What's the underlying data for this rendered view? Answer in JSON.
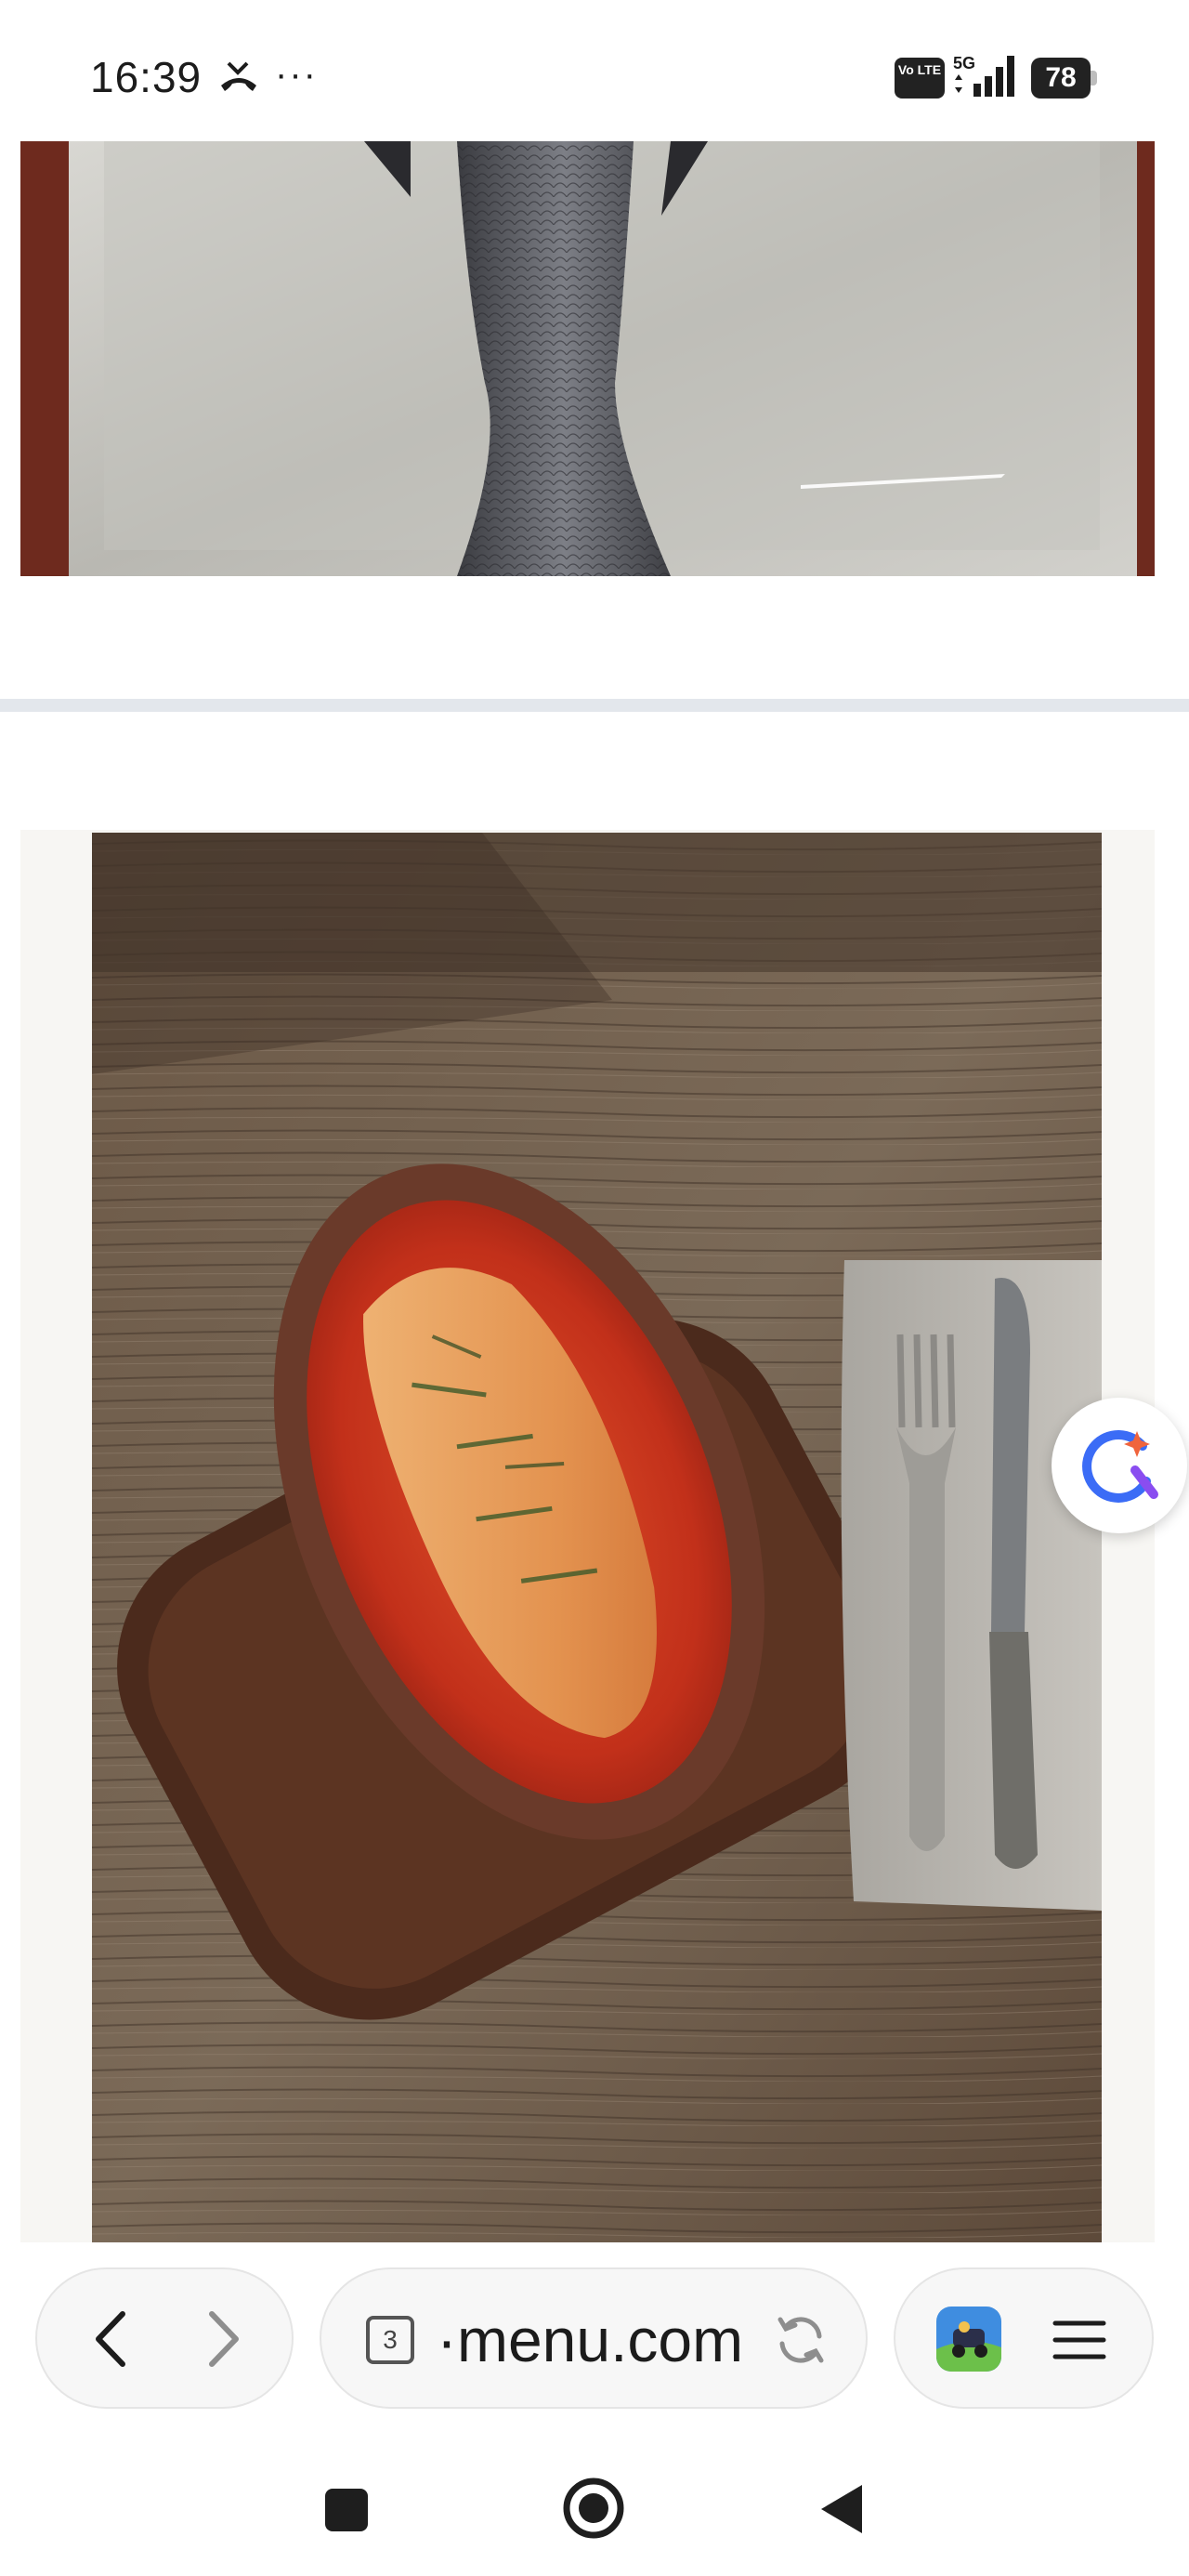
{
  "status_bar": {
    "time": "16:39",
    "more": "···",
    "volte_label": "Vo LTE",
    "network": "5G",
    "battery_level": "78"
  },
  "images": {
    "fish_icon": "whole-fish-photo",
    "dish_icon": "baked-fish-dish-photo"
  },
  "toolbar": {
    "tab_count": "3",
    "url": "·menu.com",
    "icons": [
      "back-icon",
      "forward-icon",
      "reload-icon",
      "app-icon",
      "menu-icon"
    ]
  },
  "colors": {
    "toolbar_bg": "#f7f7f7",
    "divider": "#e3e7ec",
    "assistant_blue": "#3b6cf6"
  }
}
